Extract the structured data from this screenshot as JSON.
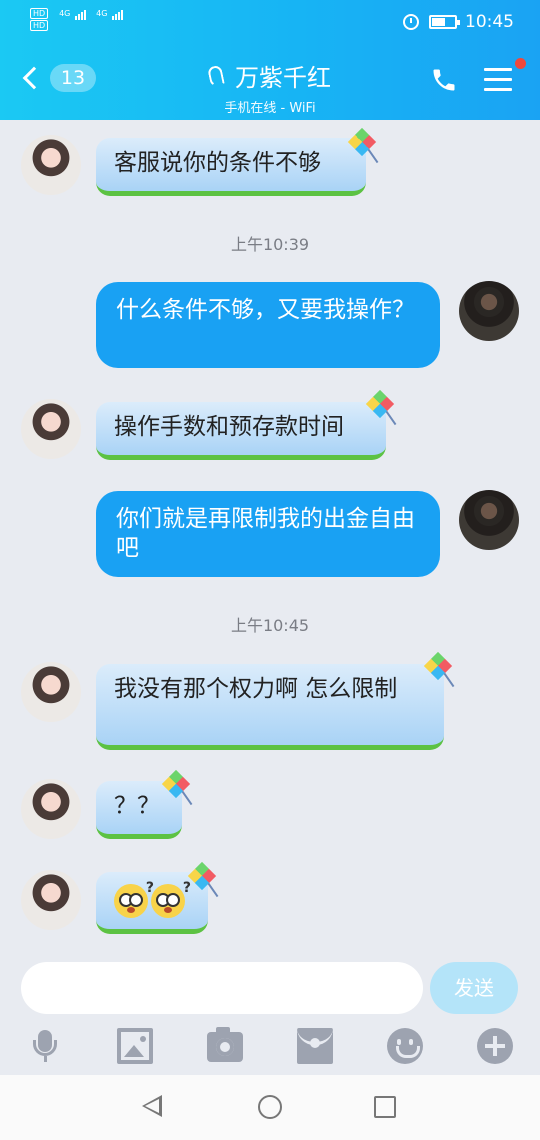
{
  "status_bar": {
    "left_badges": [
      "HD",
      "HD"
    ],
    "signal_labels": [
      "4G",
      "4G"
    ],
    "time": "10:45",
    "battery_level": 0.6
  },
  "header": {
    "back_count": "13",
    "contact_name": "万紫千红",
    "contact_status": "手机在线 - WiFi",
    "call_icon": "phone-icon",
    "menu_icon": "menu-icon",
    "notification_color": "#f0483c"
  },
  "messages": [
    {
      "side": "in",
      "text": "客服说你的条件不够"
    },
    {
      "type": "time",
      "text": "上午10:39"
    },
    {
      "side": "out",
      "text": "什么条件不够，又要我操作？"
    },
    {
      "side": "in",
      "text": "操作手数和预存款时间"
    },
    {
      "side": "out",
      "text": "你们就是再限制我的出金自由吧"
    },
    {
      "type": "time",
      "text": "上午10:45"
    },
    {
      "side": "in",
      "text": "我没有那个权力啊 怎么限制"
    },
    {
      "side": "in",
      "text": "？？"
    },
    {
      "side": "in",
      "emoji": [
        "dizzy-emoji",
        "dizzy-emoji"
      ],
      "emoji_mark": "?"
    }
  ],
  "composer": {
    "placeholder": "",
    "send_label": "发送"
  },
  "toolbar": {
    "icons": [
      "microphone-icon",
      "image-icon",
      "camera-icon",
      "red-packet-icon",
      "emoji-icon",
      "plus-icon"
    ]
  },
  "nav": {
    "icons": [
      "back-icon",
      "home-icon",
      "recents-icon"
    ]
  },
  "colors": {
    "header_gradient_start": "#1bc9f3",
    "header_gradient_end": "#1aa3f3",
    "outgoing_bubble": "#19a1f3",
    "incoming_bubble": "#a9d3f6",
    "send_button": "#b4e4f9",
    "chat_background": "#e8ebf1"
  }
}
